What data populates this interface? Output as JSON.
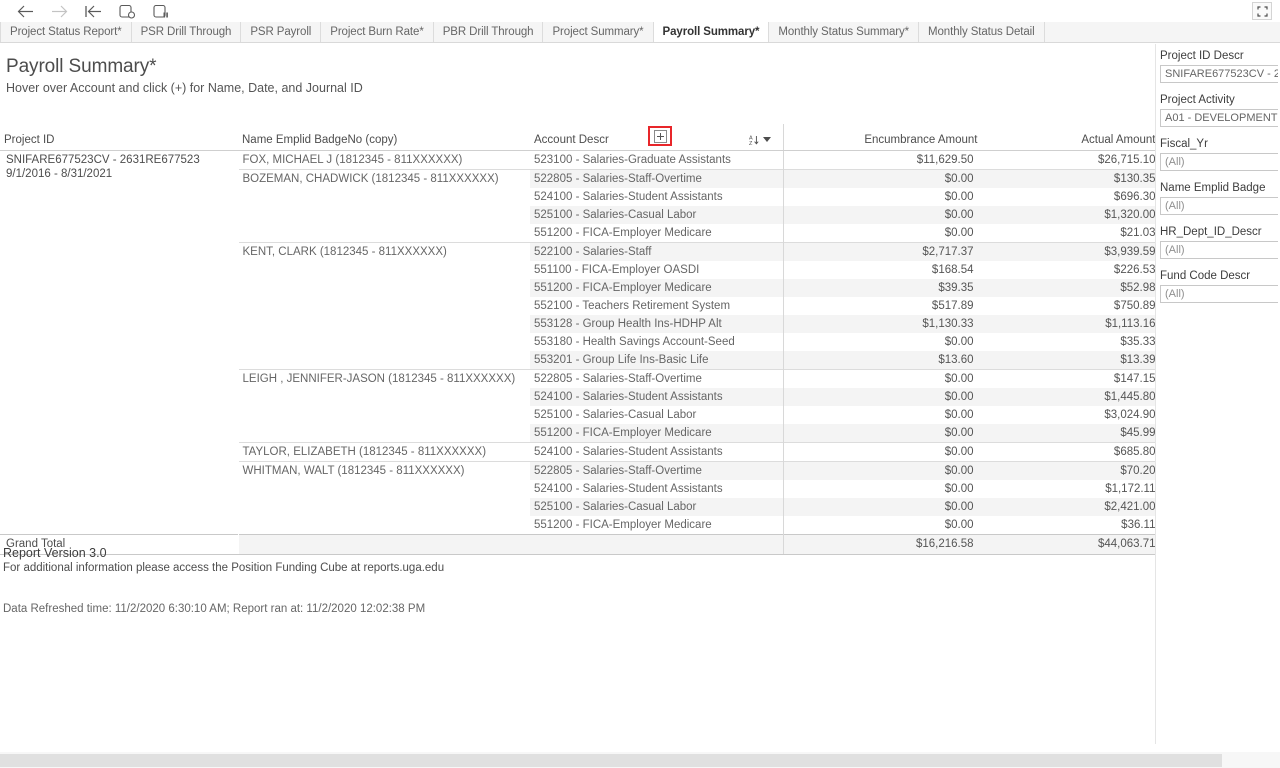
{
  "toolbar": {
    "icons": [
      {
        "name": "back-arrow-icon",
        "label": "Back"
      },
      {
        "name": "forward-arrow-icon",
        "label": "Forward"
      },
      {
        "name": "revert-all-icon",
        "label": "Revert All"
      },
      {
        "name": "refresh-data-icon",
        "label": "Refresh Data Source"
      },
      {
        "name": "pause-updates-icon",
        "label": "Pause Automatic Updates"
      }
    ],
    "fullscreen_label": "Full Screen"
  },
  "tabs": [
    {
      "label": "Project Status Report*",
      "active": false
    },
    {
      "label": "PSR Drill Through",
      "active": false
    },
    {
      "label": "PSR Payroll",
      "active": false
    },
    {
      "label": "Project Burn Rate*",
      "active": false
    },
    {
      "label": "PBR Drill Through",
      "active": false
    },
    {
      "label": "Project Summary*",
      "active": false
    },
    {
      "label": "Payroll Summary*",
      "active": true
    },
    {
      "label": "Monthly Status Summary*",
      "active": false
    },
    {
      "label": "Monthly Status Detail",
      "active": false
    }
  ],
  "sheet": {
    "title": "Payroll Summary*",
    "subtitle": "Hover over Account and click (+) for Name, Date, and Journal ID"
  },
  "table": {
    "headers": {
      "project_id": "Project ID",
      "name_emplid": "Name Emplid BadgeNo (copy)",
      "account_descr": "Account Descr",
      "encumbrance": "Encumbrance Amount",
      "actual": "Actual Amount"
    },
    "project": {
      "line1": "SNIFARE677523CV - 2631RE677523",
      "line2": "9/1/2016 - 8/31/2021"
    },
    "rows": [
      {
        "name": "FOX, MICHAEL J (1812345 - 811XXXXXX)",
        "account": "523100 - Salaries-Graduate Assistants",
        "enc": "$11,629.50",
        "act": "$26,715.10",
        "shade": false,
        "group_start": true
      },
      {
        "name": "BOZEMAN, CHADWICK (1812345 - 811XXXXXX)",
        "account": "522805 - Salaries-Staff-Overtime",
        "enc": "$0.00",
        "act": "$130.35",
        "shade": true,
        "group_start": true
      },
      {
        "name": "",
        "account": "524100 - Salaries-Student Assistants",
        "enc": "$0.00",
        "act": "$696.30",
        "shade": false,
        "group_start": false
      },
      {
        "name": "",
        "account": "525100 - Salaries-Casual Labor",
        "enc": "$0.00",
        "act": "$1,320.00",
        "shade": true,
        "group_start": false
      },
      {
        "name": "",
        "account": "551200 - FICA-Employer Medicare",
        "enc": "$0.00",
        "act": "$21.03",
        "shade": false,
        "group_start": false
      },
      {
        "name": "KENT, CLARK (1812345 - 811XXXXXX)",
        "account": "522100 - Salaries-Staff",
        "enc": "$2,717.37",
        "act": "$3,939.59",
        "shade": true,
        "group_start": true
      },
      {
        "name": "",
        "account": "551100 - FICA-Employer OASDI",
        "enc": "$168.54",
        "act": "$226.53",
        "shade": false,
        "group_start": false
      },
      {
        "name": "",
        "account": "551200 - FICA-Employer Medicare",
        "enc": "$39.35",
        "act": "$52.98",
        "shade": true,
        "group_start": false
      },
      {
        "name": "",
        "account": "552100 - Teachers Retirement System",
        "enc": "$517.89",
        "act": "$750.89",
        "shade": false,
        "group_start": false
      },
      {
        "name": "",
        "account": "553128 - Group Health Ins-HDHP Alt",
        "enc": "$1,130.33",
        "act": "$1,113.16",
        "shade": true,
        "group_start": false
      },
      {
        "name": "",
        "account": "553180 - Health Savings Account-Seed",
        "enc": "$0.00",
        "act": "$35.33",
        "shade": false,
        "group_start": false
      },
      {
        "name": "",
        "account": "553201 - Group Life Ins-Basic Life",
        "enc": "$13.60",
        "act": "$13.39",
        "shade": true,
        "group_start": false
      },
      {
        "name": "LEIGH , JENNIFER-JASON (1812345 - 811XXXXXX)",
        "account": "522805 - Salaries-Staff-Overtime",
        "enc": "$0.00",
        "act": "$147.15",
        "shade": false,
        "group_start": true
      },
      {
        "name": "",
        "account": "524100 - Salaries-Student Assistants",
        "enc": "$0.00",
        "act": "$1,445.80",
        "shade": true,
        "group_start": false
      },
      {
        "name": "",
        "account": "525100 - Salaries-Casual Labor",
        "enc": "$0.00",
        "act": "$3,024.90",
        "shade": false,
        "group_start": false
      },
      {
        "name": "",
        "account": "551200 - FICA-Employer Medicare",
        "enc": "$0.00",
        "act": "$45.99",
        "shade": true,
        "group_start": false
      },
      {
        "name": "TAYLOR, ELIZABETH (1812345 - 811XXXXXX)",
        "account": "524100 - Salaries-Student Assistants",
        "enc": "$0.00",
        "act": "$685.80",
        "shade": false,
        "group_start": true
      },
      {
        "name": "WHITMAN, WALT (1812345 - 811XXXXXX)",
        "account": "522805 - Salaries-Staff-Overtime",
        "enc": "$0.00",
        "act": "$70.20",
        "shade": true,
        "group_start": true
      },
      {
        "name": "",
        "account": "524100 - Salaries-Student Assistants",
        "enc": "$0.00",
        "act": "$1,172.11",
        "shade": false,
        "group_start": false
      },
      {
        "name": "",
        "account": "525100 - Salaries-Casual Labor",
        "enc": "$0.00",
        "act": "$2,421.00",
        "shade": true,
        "group_start": false
      },
      {
        "name": "",
        "account": "551200 - FICA-Employer Medicare",
        "enc": "$0.00",
        "act": "$36.11",
        "shade": false,
        "group_start": false
      }
    ],
    "grand_total": {
      "label": "Grand Total",
      "enc": "$16,216.58",
      "act": "$44,063.71"
    }
  },
  "footer": {
    "version": "Report Version 3.0",
    "info": "For additional information please access the Position Funding Cube at reports.uga.edu",
    "data_refreshed": "Data Refreshed time: 11/2/2020 6:30:10 AM; Report ran at: 11/2/2020 12:02:38 PM"
  },
  "filters": [
    {
      "label": "Project ID Descr",
      "value": "SNIFARE677523CV - 2",
      "placeholder": false
    },
    {
      "label": "Project Activity",
      "value": "A01 - DEVELOPMENT",
      "placeholder": false
    },
    {
      "label": "Fiscal_Yr",
      "value": "(All)",
      "placeholder": true
    },
    {
      "label": "Name Emplid Badge",
      "value": "(All)",
      "placeholder": true
    },
    {
      "label": "HR_Dept_ID_Descr",
      "value": "(All)",
      "placeholder": true
    },
    {
      "label": "Fund Code Descr",
      "value": "(All)",
      "placeholder": true
    }
  ],
  "colors": {
    "highlight_red": "#e8262a",
    "row_shade": "#f4f4f4",
    "text": "#5a5a5a"
  }
}
